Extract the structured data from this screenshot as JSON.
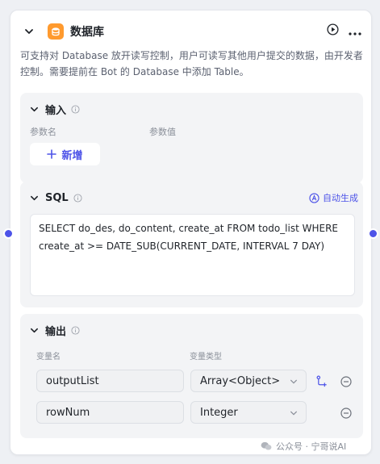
{
  "node": {
    "title": "数据库",
    "description": "可支持对 Database 放开读写控制，用户可读写其他用户提交的数据，由开发者控制。需要提前在 Bot 的 Database 中添加 Table。"
  },
  "input": {
    "title": "输入",
    "col_name": "参数名",
    "col_value": "参数值",
    "add_label": "新增"
  },
  "sql": {
    "title": "SQL",
    "auto_generate": "自动生成",
    "query": "SELECT do_des, do_content, create_at FROM todo_list WHERE create_at >= DATE_SUB(CURRENT_DATE, INTERVAL 7 DAY)"
  },
  "output": {
    "title": "输出",
    "col_name": "变量名",
    "col_type": "变量类型",
    "rows": [
      {
        "name": "outputList",
        "type": "Array<Object>"
      },
      {
        "name": "rowNum",
        "type": "Integer"
      }
    ]
  },
  "watermark": "公众号 · 宁哥说AI",
  "colors": {
    "accent": "#4d53e8",
    "db_icon": "#ff9a2e"
  }
}
